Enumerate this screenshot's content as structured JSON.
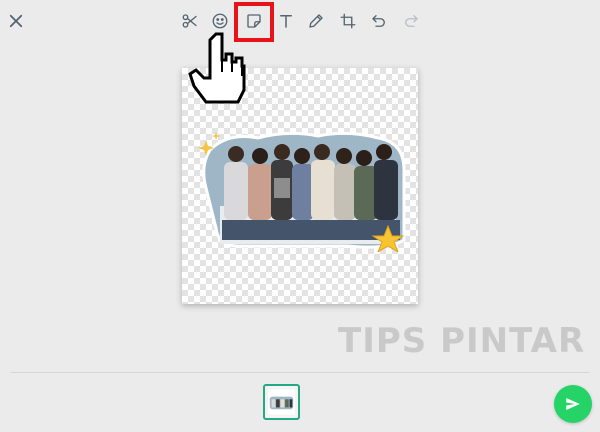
{
  "toolbar": {
    "icons": [
      "close-icon",
      "scissors-icon",
      "emoji-icon",
      "sticker-icon",
      "text-icon",
      "pencil-icon",
      "crop-rotate-icon",
      "undo-icon",
      "redo-icon"
    ],
    "highlighted": "sticker-icon",
    "highlight_color": "#e8121b"
  },
  "watermark": {
    "text": "TIPS PINTAR"
  },
  "colors": {
    "accent": "#25d366",
    "thumb_border": "#25a884",
    "icon": "#54656f"
  },
  "bottom_bar": {
    "send_icon": "send-icon"
  }
}
